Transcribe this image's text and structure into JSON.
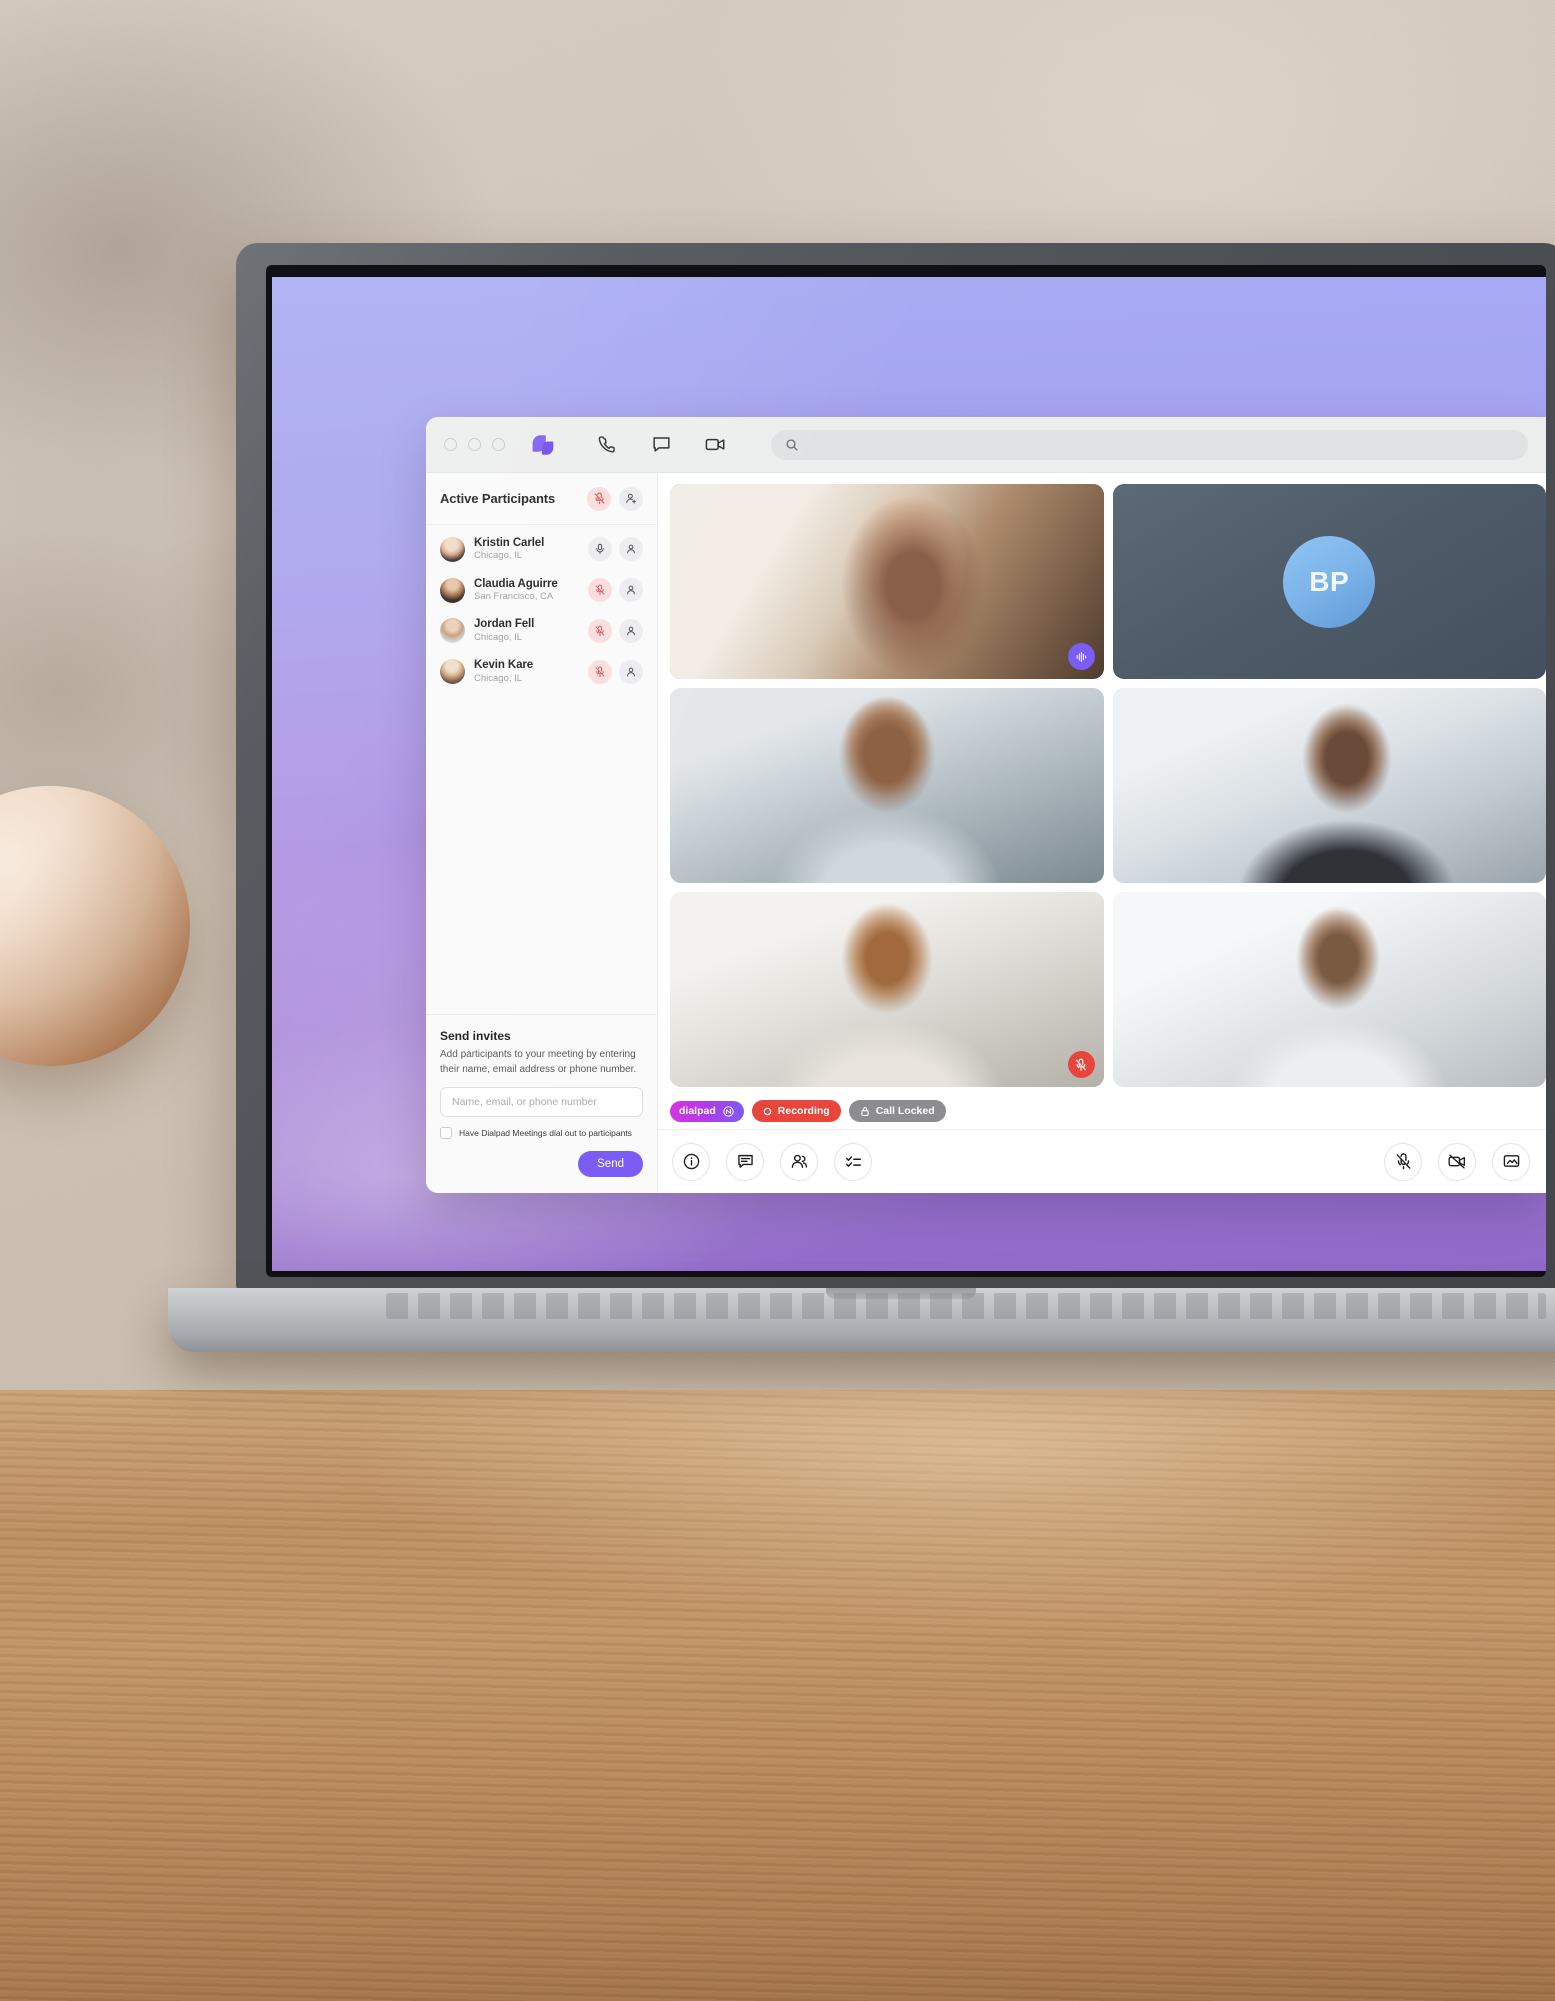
{
  "window": {
    "traffic_lights": [
      "close",
      "minimize",
      "zoom"
    ],
    "logo": "dialpad-logo",
    "toolbar_icons": [
      "phone-icon",
      "chat-icon",
      "video-camera-icon"
    ],
    "search": {
      "placeholder": "",
      "value": "",
      "icon": "search-icon"
    }
  },
  "sidebar": {
    "header": {
      "title": "Active Participants",
      "mute_all_icon": "microphone-off-icon",
      "add_participant_icon": "person-add-icon"
    },
    "participants": [
      {
        "name": "Kristin Carlel",
        "location": "Chicago, IL",
        "muted": false,
        "mic_icon": "microphone-icon",
        "person_icon": "person-icon"
      },
      {
        "name": "Claudia Aguirre",
        "location": "San Francisco, CA",
        "muted": true,
        "mic_icon": "microphone-off-icon",
        "person_icon": "person-icon"
      },
      {
        "name": "Jordan Fell",
        "location": "Chicago, IL",
        "muted": true,
        "mic_icon": "microphone-off-icon",
        "person_icon": "person-icon"
      },
      {
        "name": "Kevin Kare",
        "location": "Chicago, IL",
        "muted": true,
        "mic_icon": "microphone-off-icon",
        "person_icon": "person-icon"
      }
    ],
    "invites": {
      "title": "Send invites",
      "description": "Add participants to your meeting by entering their name, email address or phone number.",
      "input_placeholder": "Name, email, or phone number",
      "input_value": "",
      "checkbox_label": "Have Dialpad Meetings dial out to participants",
      "checkbox_checked": false,
      "send_label": "Send"
    }
  },
  "stage": {
    "tiles": [
      {
        "id": "tile-1",
        "type": "video",
        "active": true,
        "badge_icon": "audio-wave-icon",
        "badge_color": "purple",
        "label": ""
      },
      {
        "id": "tile-2",
        "type": "initials",
        "active": false,
        "initials": "BP",
        "label": ""
      },
      {
        "id": "tile-3",
        "type": "video",
        "active": false,
        "label": ""
      },
      {
        "id": "tile-4",
        "type": "video",
        "active": false,
        "label": ""
      },
      {
        "id": "tile-5",
        "type": "video",
        "active": false,
        "badge_icon": "microphone-off-icon",
        "badge_color": "red",
        "label": ""
      },
      {
        "id": "tile-6",
        "type": "video",
        "active": false,
        "label": ""
      }
    ],
    "badges": [
      {
        "id": "dialpad",
        "label": "dialpad",
        "icon": "dialpad-mark-icon",
        "color": "#b23ae8"
      },
      {
        "id": "recording",
        "label": "Recording",
        "icon": "record-circle-icon",
        "color": "#e8453c"
      },
      {
        "id": "call-locked",
        "label": "Call Locked",
        "icon": "lock-icon",
        "color": "#8d8d91"
      }
    ],
    "controls_left": [
      {
        "id": "info",
        "icon": "info-icon"
      },
      {
        "id": "chat",
        "icon": "chat-icon"
      },
      {
        "id": "participants",
        "icon": "people-icon"
      },
      {
        "id": "checklist",
        "icon": "checklist-icon"
      }
    ],
    "controls_right": [
      {
        "id": "mute",
        "icon": "microphone-off-icon"
      },
      {
        "id": "video-off",
        "icon": "video-off-icon"
      },
      {
        "id": "share-screen",
        "icon": "screen-share-icon"
      }
    ]
  },
  "colors": {
    "accent": "#7b5cf5",
    "recording": "#e8453c",
    "locked": "#8d8d91",
    "dialpad_start": "#d435e0"
  }
}
